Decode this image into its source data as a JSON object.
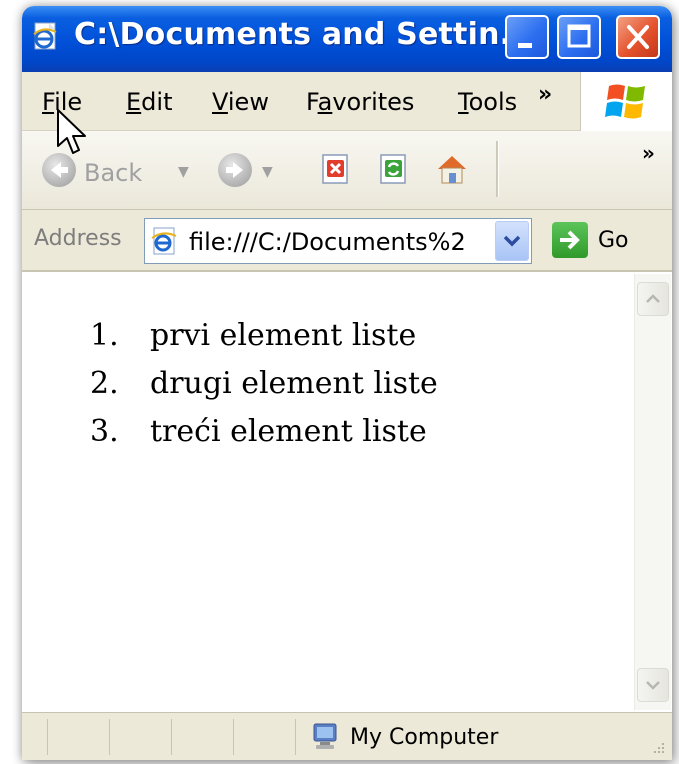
{
  "window": {
    "title": "C:\\Documents and Settin..."
  },
  "menu": {
    "items": [
      {
        "label": "File",
        "accel": "F"
      },
      {
        "label": "Edit",
        "accel": "E"
      },
      {
        "label": "View",
        "accel": "V"
      },
      {
        "label": "Favorites",
        "accel": "a"
      },
      {
        "label": "Tools",
        "accel": "T"
      }
    ],
    "more": "»"
  },
  "toolbar": {
    "back_label": "Back",
    "more": "»"
  },
  "address": {
    "label": "Address",
    "value": "file:///C:/Documents%2",
    "go_label": "Go"
  },
  "content": {
    "list": [
      {
        "num": "1.",
        "text": "prvi element liste"
      },
      {
        "num": "2.",
        "text": "drugi element liste"
      },
      {
        "num": "3.",
        "text": "treći element liste"
      }
    ]
  },
  "status": {
    "zone": "My Computer"
  },
  "icons": {
    "title": "ie-page-icon",
    "minimize": "minimize-icon",
    "maximize": "maximize-icon",
    "close": "close-icon",
    "logo": "windows-logo-icon",
    "back": "back-arrow-icon",
    "forward": "forward-arrow-icon",
    "stop": "stop-icon",
    "refresh": "refresh-icon",
    "home": "home-icon",
    "go": "go-arrow-icon",
    "computer": "my-computer-icon"
  },
  "colors": {
    "titlebar": "#0050d8",
    "close": "#e5532e",
    "chrome": "#ece9d8"
  }
}
